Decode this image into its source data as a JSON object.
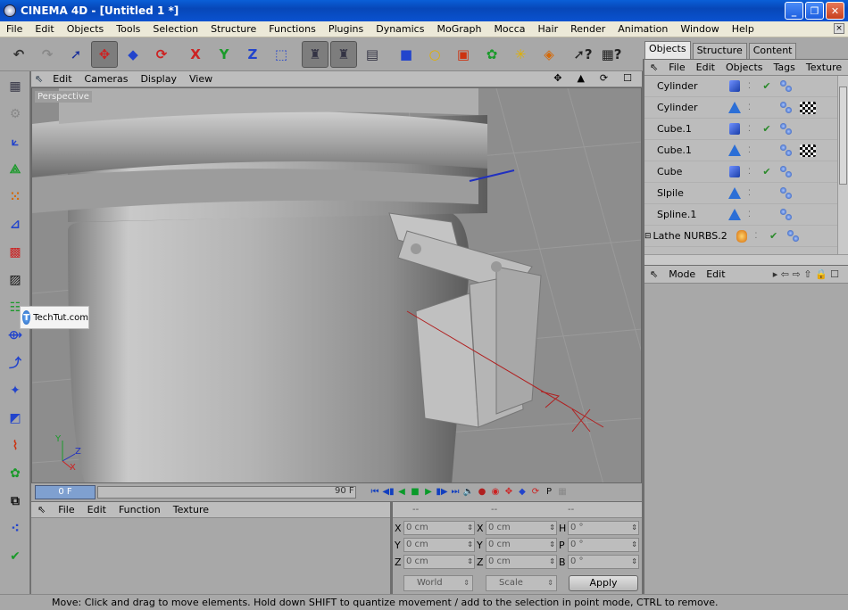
{
  "window": {
    "title": "CINEMA 4D - [Untitled 1 *]",
    "buttons": [
      "_",
      "❐",
      "✕"
    ]
  },
  "menubar": [
    "File",
    "Edit",
    "Objects",
    "Tools",
    "Selection",
    "Structure",
    "Functions",
    "Plugins",
    "Dynamics",
    "MoGraph",
    "Mocca",
    "Hair",
    "Render",
    "Animation",
    "Window",
    "Help"
  ],
  "toolbar": {
    "items": [
      {
        "name": "undo-icon",
        "glyph": "↶",
        "color": "#333"
      },
      {
        "name": "redo-icon",
        "glyph": "↷",
        "color": "#888"
      },
      {
        "name": "select-arrow-icon",
        "glyph": "➚",
        "color": "#1a2f9a"
      },
      {
        "name": "move-tool-icon",
        "glyph": "✥",
        "color": "#cc2222",
        "selected": true
      },
      {
        "name": "scale-tool-icon",
        "glyph": "◆",
        "color": "#2244cc"
      },
      {
        "name": "rotate-tool-icon",
        "glyph": "⟳",
        "color": "#cc2222"
      },
      {
        "name": "sep"
      },
      {
        "name": "x-axis-icon",
        "glyph": "X",
        "color": "#cc2222"
      },
      {
        "name": "y-axis-icon",
        "glyph": "Y",
        "color": "#1a9a2a"
      },
      {
        "name": "z-axis-icon",
        "glyph": "Z",
        "color": "#2244cc"
      },
      {
        "name": "coord-system-icon",
        "glyph": "⬚",
        "color": "#2244cc"
      },
      {
        "name": "sep"
      },
      {
        "name": "render-view-icon",
        "glyph": "♜",
        "color": "#334",
        "selected": true
      },
      {
        "name": "render-picture-viewer-icon",
        "glyph": "♜",
        "color": "#334",
        "selected": true
      },
      {
        "name": "render-settings-icon",
        "glyph": "▤",
        "color": "#334"
      },
      {
        "name": "sep"
      },
      {
        "name": "cube-object-icon",
        "glyph": "■",
        "color": "#2244cc"
      },
      {
        "name": "spline-circle-icon",
        "glyph": "○",
        "color": "#e0b000"
      },
      {
        "name": "nurbs-icon",
        "glyph": "▣",
        "color": "#cc3311"
      },
      {
        "name": "array-icon",
        "glyph": "✿",
        "color": "#1a9a2a"
      },
      {
        "name": "deformer-icon",
        "glyph": "✳",
        "color": "#e0b000"
      },
      {
        "name": "light-icon",
        "glyph": "◈",
        "color": "#d46a0a"
      },
      {
        "name": "sep"
      },
      {
        "name": "help-pointer-icon",
        "glyph": "➚?",
        "color": "#222"
      },
      {
        "name": "help-window-icon",
        "glyph": "▦?",
        "color": "#222"
      }
    ]
  },
  "lefttools": [
    "layout-icon",
    "paint-icon",
    "model-mode-icon",
    "object-mode-icon",
    "points-mode-icon",
    "edges-mode-icon",
    "polygons-mode-icon",
    "texture-mode-icon",
    "texture-axis-icon",
    "animation-icon",
    "inverse-kinematics-icon",
    "bone-icon",
    "brush-icon",
    "spline-tool-icon",
    "wrap-icon",
    "morph-icon",
    "scatter-icon",
    "check-icon"
  ],
  "viewport": {
    "menu": [
      "Edit",
      "Cameras",
      "Display",
      "View"
    ],
    "label": "Perspective",
    "nav_icons": [
      "✥",
      "▲",
      "⟳",
      "☐"
    ]
  },
  "timeline": {
    "current_frame": "0 F",
    "end_frame": "90 F",
    "controls": [
      "⏮",
      "◀▮",
      "◀",
      "■",
      "▶",
      "▮▶",
      "⏭"
    ]
  },
  "material": {
    "menu": [
      "File",
      "Edit",
      "Function",
      "Texture"
    ]
  },
  "coordinates": {
    "headers": [
      "--",
      "--",
      "--"
    ],
    "rows": [
      {
        "a": "X",
        "av": "0 cm",
        "b": "X",
        "bv": "0 cm",
        "c": "H",
        "cv": "0 °"
      },
      {
        "a": "Y",
        "av": "0 cm",
        "b": "Y",
        "bv": "0 cm",
        "c": "P",
        "cv": "0 °"
      },
      {
        "a": "Z",
        "av": "0 cm",
        "b": "Z",
        "bv": "0 cm",
        "c": "B",
        "cv": "0 °"
      }
    ],
    "space_select": "World",
    "mode_select": "Scale",
    "apply_label": "Apply"
  },
  "status": "Move: Click and drag to move elements. Hold down SHIFT to quantize movement / add to the selection in point mode, CTRL to remove.",
  "right_panel": {
    "tabs": [
      "Objects",
      "Structure",
      "Content"
    ],
    "object_menu": [
      "File",
      "Edit",
      "Objects",
      "Tags",
      "Texture"
    ],
    "objects": [
      {
        "name": "Cylinder",
        "icon": "cube",
        "check": true,
        "texture": false
      },
      {
        "name": "Cylinder",
        "icon": "cone",
        "check": false,
        "texture": true
      },
      {
        "name": "Cube.1",
        "icon": "cube",
        "check": true,
        "texture": false
      },
      {
        "name": "Cube.1",
        "icon": "cone",
        "check": false,
        "texture": true
      },
      {
        "name": "Cube",
        "icon": "cube",
        "check": true,
        "texture": false
      },
      {
        "name": "Slpile",
        "icon": "cone",
        "check": false,
        "texture": false
      },
      {
        "name": "Spline.1",
        "icon": "cone",
        "check": false,
        "texture": false
      },
      {
        "name": "Lathe NURBS.2",
        "icon": "lathe",
        "check": true,
        "texture": false
      }
    ],
    "attr_menu": [
      "Mode",
      "Edit"
    ]
  },
  "watermark": "TechTut.com",
  "colors": {
    "titlebar": "#0747b8",
    "panel": "#a8a8a8",
    "viewport": "#8d8d8d",
    "frame_box": "#7fa0d0"
  }
}
